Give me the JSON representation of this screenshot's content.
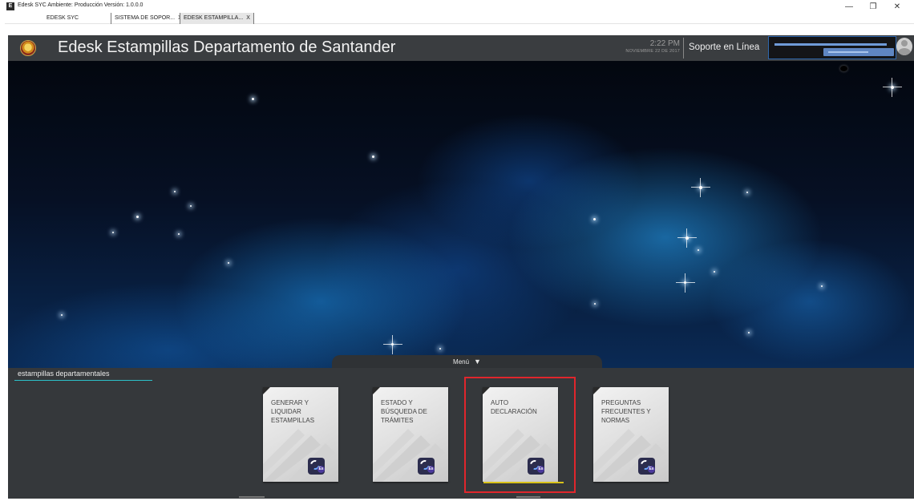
{
  "window": {
    "title": "Edesk SYC Ambiente: Producción  Versión: 1.0.0.0",
    "icon_letter": "E",
    "minimize": "—",
    "maximize": "❐",
    "close": "✕"
  },
  "tabs": [
    {
      "label": "EDESK SYC",
      "close": ""
    },
    {
      "label": "SISTEMA DE SOPOR...",
      "close": "X"
    },
    {
      "label": "EDESK ESTAMPILLA...",
      "close": "X"
    }
  ],
  "header": {
    "title": "Edesk Estampillas Departamento de Santander",
    "time": "2:22 PM",
    "date": "NOVIEMBRE 22 DE 2017",
    "support": "Soporte en Línea"
  },
  "menu": {
    "label": "Menú",
    "arrow": "▼"
  },
  "section": {
    "label": "estampillas departamentales"
  },
  "tiles": [
    {
      "label": "GENERAR Y LIQUIDAR ESTAMPILLAS",
      "icon_text": "Es"
    },
    {
      "label": "ESTADO Y BÚSQUEDA DE TRÁMITES",
      "icon_text": "Es"
    },
    {
      "label": "AUTO DECLARACIÓN",
      "icon_text": "Es"
    },
    {
      "label": "PREGUNTAS FRECUENTES Y NORMAS",
      "icon_text": "Es"
    }
  ],
  "colors": {
    "header_bg": "#3a3d40",
    "panel_bg": "#35383b",
    "highlight": "#e0262c",
    "selected_underline": "#d8c21a",
    "section_underline": "#2cc0c9",
    "user_box_border": "#2f67ae"
  }
}
